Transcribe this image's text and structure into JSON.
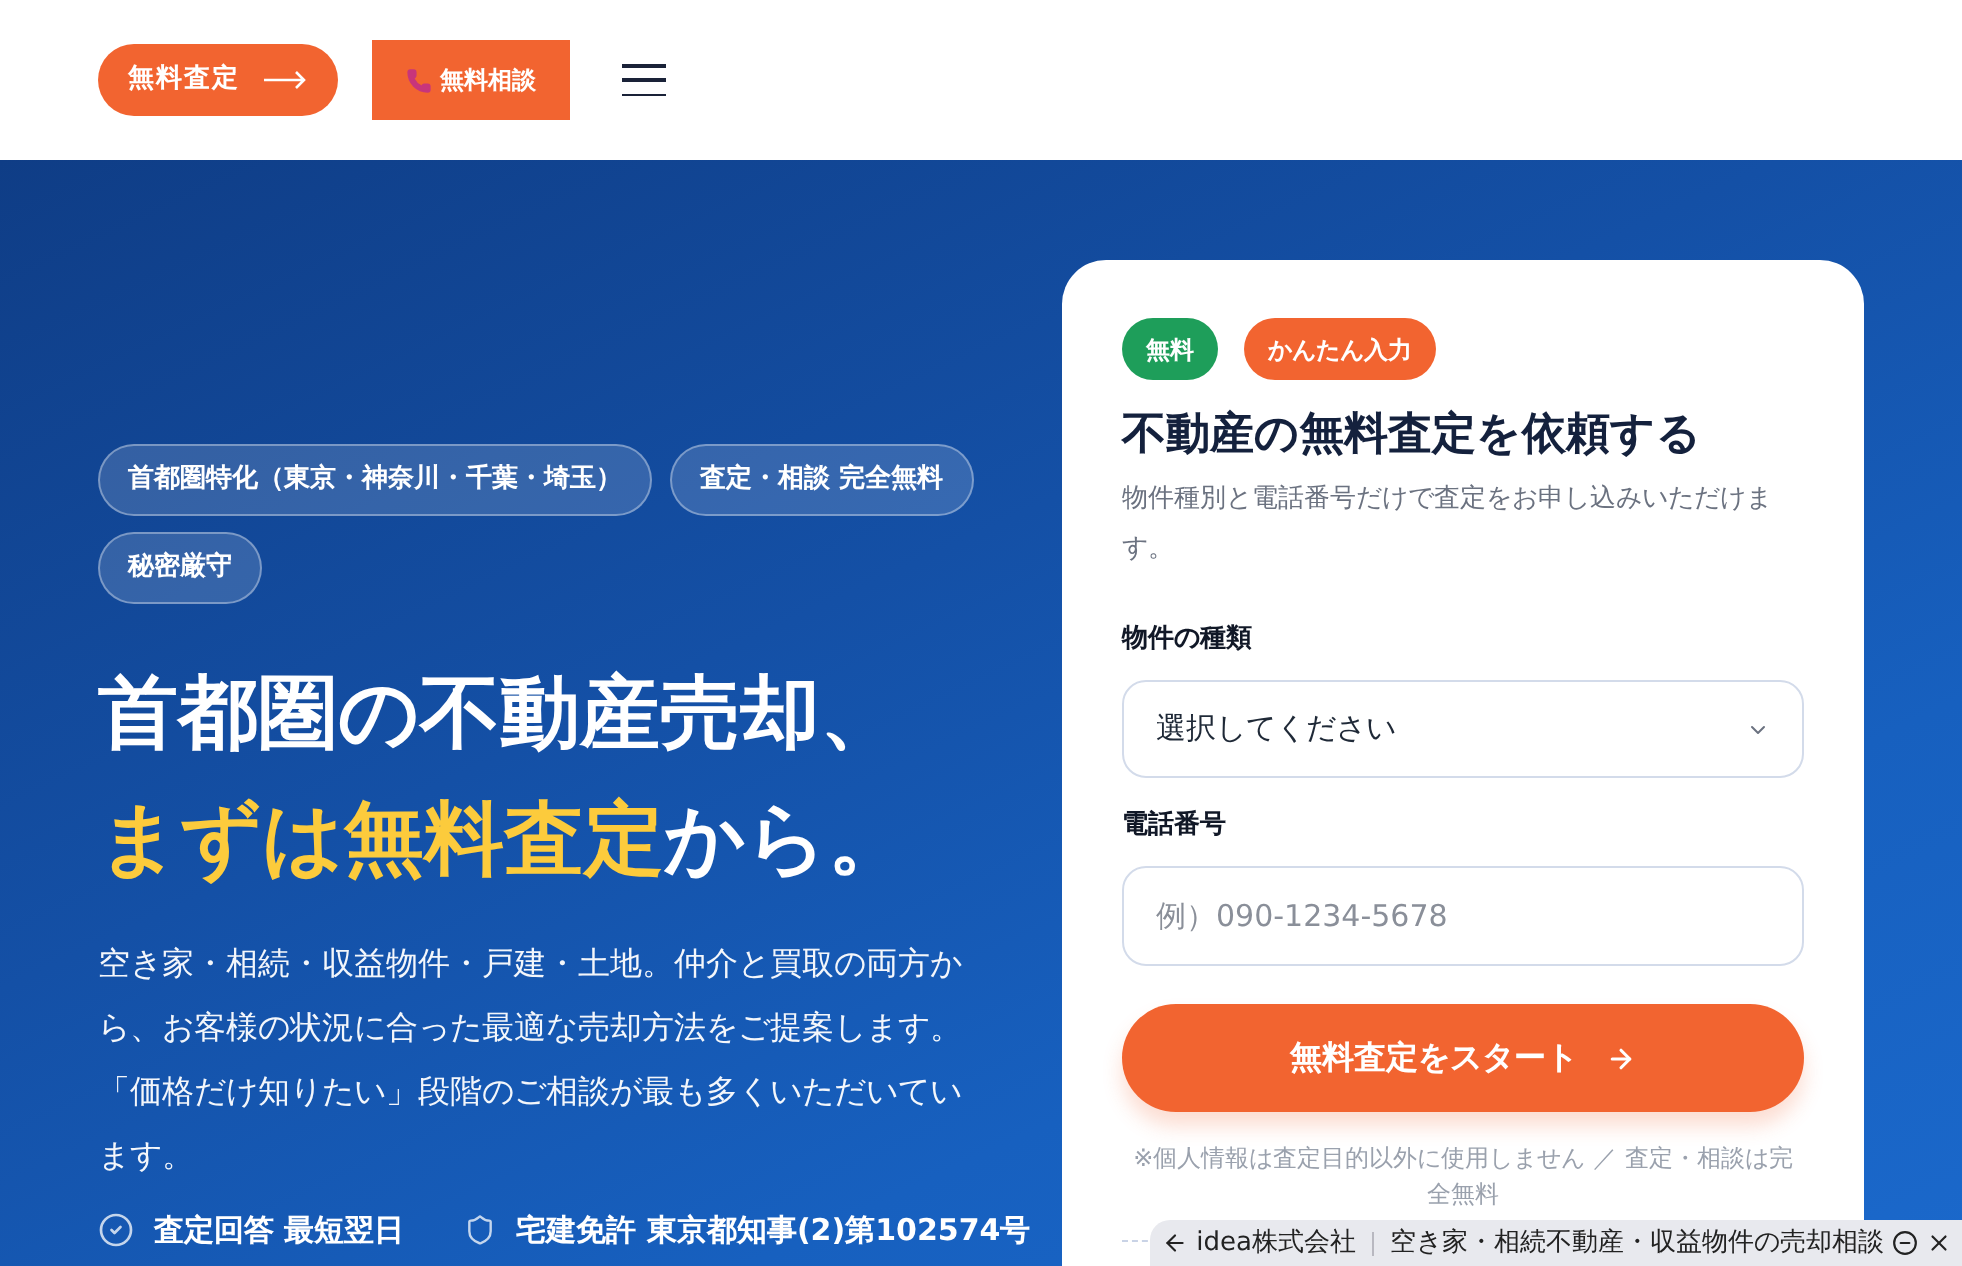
{
  "header": {
    "buttons": [
      {
        "kind": "pill",
        "label": "無料査定"
      },
      {
        "kind": "phone",
        "label": "無料相談"
      }
    ]
  },
  "hero": {
    "tags": [
      "首都圏特化（東京・神奈川・千葉・埼玉）",
      "査定・相談 完全無料",
      "秘密厳守"
    ],
    "heading": [
      [
        {
          "text": "首都圏の不動産売却、",
          "highlight": false
        }
      ],
      [
        {
          "text": "まずは無料査定",
          "highlight": true
        },
        {
          "text": "から。",
          "highlight": false
        }
      ]
    ],
    "description": "空き家・相続・収益物件・戸建・土地。仲介と買取の両方から、お客様の状況に合った最適な売却方法をご提案します。「価格だけ知りたい」段階のご相談が最も多くいただいています。",
    "features": [
      {
        "kind": "check",
        "label": "査定回答 最短翌日"
      },
      {
        "kind": "shield",
        "label": "宅建免許 東京都知事(2)第102574号"
      }
    ]
  },
  "form": {
    "badges": [
      {
        "label": "無料",
        "color": "#1e9e5a"
      },
      {
        "label": "かんたん入力",
        "color": "#f26430"
      }
    ],
    "title": "不動産の無料査定を依頼する",
    "description": "物件種別と電話番号だけで査定をお申し込みいただけます。",
    "fields": [
      {
        "kind": "select",
        "label": "物件の種類",
        "value": "選択してください"
      },
      {
        "kind": "text",
        "label": "電話番号",
        "placeholder": "例）090-1234-5678"
      }
    ],
    "submit": "無料査定をスタート",
    "note": "※個人情報は査定目的以外に使用しません ／ 査定・相談は完全無料"
  },
  "overlay_bar": {
    "site": "idea株式会社",
    "title": "空き家・相続不動産・収益物件の売却相談"
  }
}
